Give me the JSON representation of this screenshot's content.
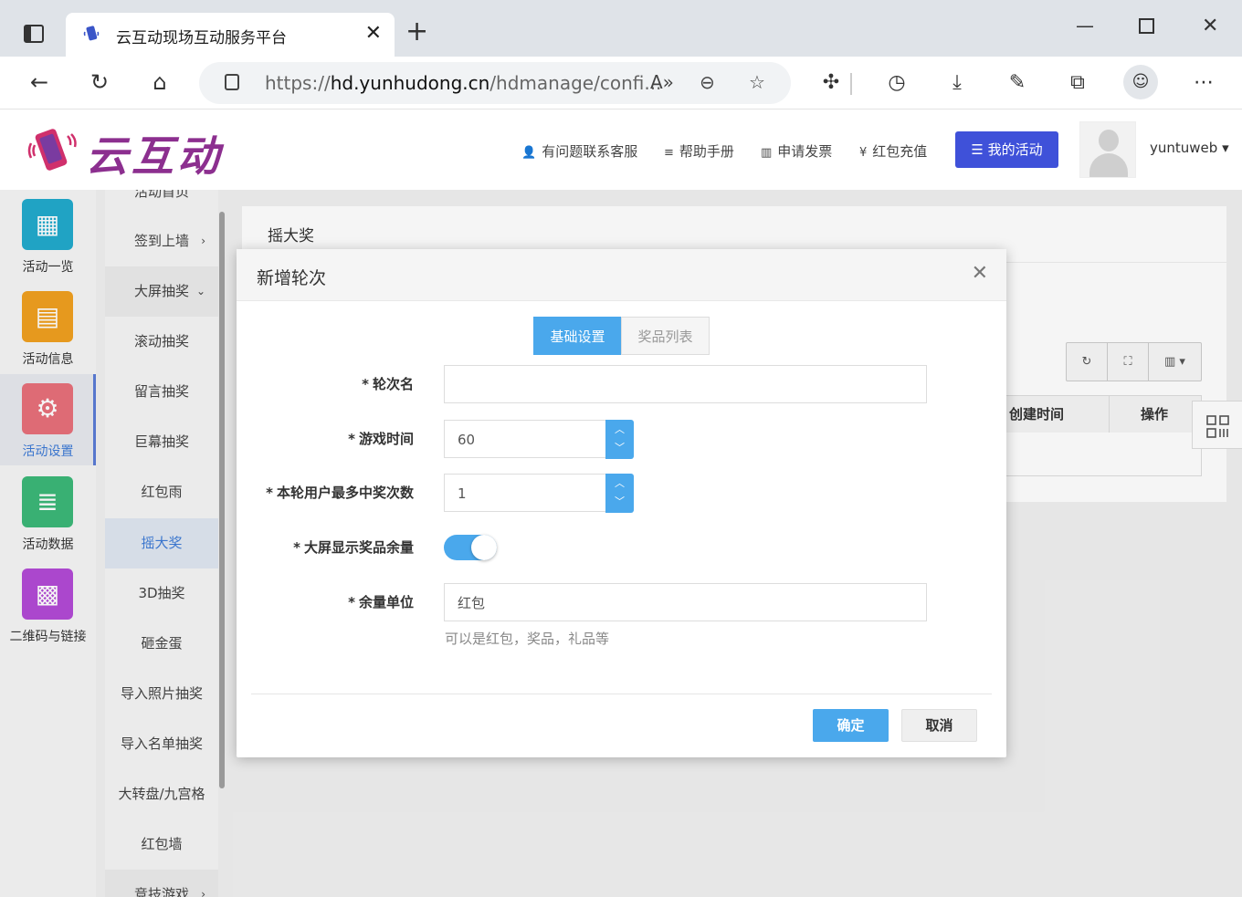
{
  "browser": {
    "tab_title": "云互动现场互动服务平台",
    "url_prefix": "https://",
    "url_domain": "hd.yunhudong.cn",
    "url_path": "/hdmanage/confi..."
  },
  "header": {
    "logo_text": "云互动",
    "links": {
      "contact": "有问题联系客服",
      "help": "帮助手册",
      "invoice": "申请发票",
      "recharge": "红包充值"
    },
    "my_activities": "我的活动",
    "username": "yuntuweb"
  },
  "sidebar_main": {
    "items": [
      {
        "label": "活动一览",
        "icon": "grid-icon",
        "color": "#22aacc"
      },
      {
        "label": "活动信息",
        "icon": "document-icon",
        "color": "#f0a020"
      },
      {
        "label": "活动设置",
        "icon": "gear-icon",
        "color": "#e8707a"
      },
      {
        "label": "活动数据",
        "icon": "database-icon",
        "color": "#3cb878"
      },
      {
        "label": "二维码与链接",
        "icon": "qrcode-icon",
        "color": "#b24ad6"
      }
    ]
  },
  "sidebar_sub": {
    "items": [
      {
        "label": "活动首页"
      },
      {
        "label": "签到上墙"
      },
      {
        "label": "大屏抽奖"
      },
      {
        "label": "滚动抽奖"
      },
      {
        "label": "留言抽奖"
      },
      {
        "label": "巨幕抽奖"
      },
      {
        "label": "红包雨"
      },
      {
        "label": "摇大奖"
      },
      {
        "label": "3D抽奖"
      },
      {
        "label": "砸金蛋"
      },
      {
        "label": "导入照片抽奖"
      },
      {
        "label": "导入名单抽奖"
      },
      {
        "label": "大转盘/九宫格"
      },
      {
        "label": "红包墙"
      },
      {
        "label": "竞技游戏"
      }
    ]
  },
  "main": {
    "title": "摇大奖",
    "table_headers": [
      "创建时间",
      "操作"
    ]
  },
  "modal": {
    "title": "新增轮次",
    "tabs": [
      "基础设置",
      "奖品列表"
    ],
    "fields": {
      "round_name": {
        "label": "轮次名",
        "value": ""
      },
      "game_time": {
        "label": "游戏时间",
        "value": "60"
      },
      "max_wins": {
        "label": "本轮用户最多中奖次数",
        "value": "1"
      },
      "show_remaining": {
        "label": "大屏显示奖品余量",
        "on": true
      },
      "remaining_unit": {
        "label": "余量单位",
        "value": "红包",
        "hint": "可以是红包，奖品，礼品等"
      }
    },
    "confirm": "确定",
    "cancel": "取消"
  },
  "colors": {
    "accent": "#4aa8ec",
    "primary_button": "#3f51d9",
    "logo": "#8c2f8f"
  }
}
